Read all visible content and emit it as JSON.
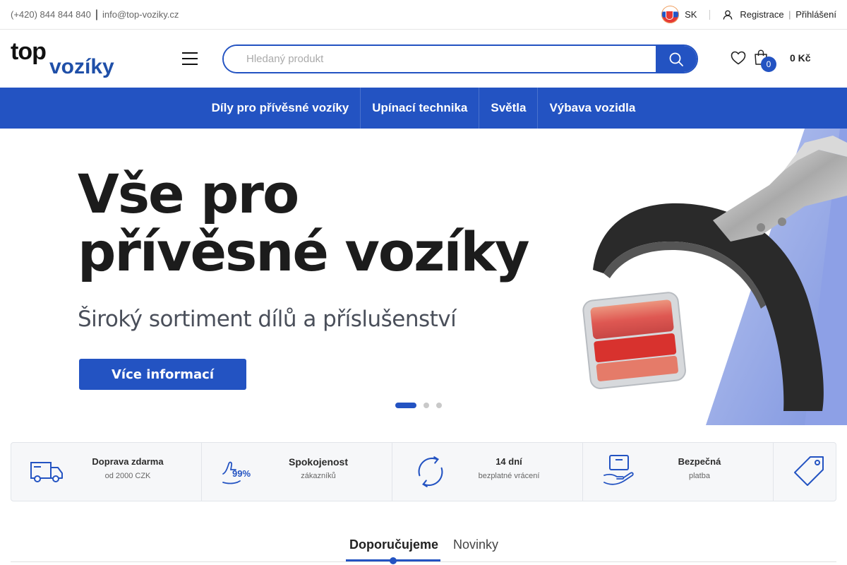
{
  "topbar": {
    "phone": "(+420) 844 844 840",
    "separator": "|",
    "email": "info@top-voziky.cz",
    "language": "SK",
    "register": "Registrace",
    "auth_separator": "|",
    "login": "Přihlášení"
  },
  "header": {
    "logo_top": "top",
    "logo_bottom": "vozíky",
    "search_placeholder": "Hledaný produkt",
    "cart_count": "0",
    "cart_total": "0 Kč"
  },
  "nav": {
    "items": [
      "Díly pro přívěsné vozíky",
      "Upínací technika",
      "Světla",
      "Výbava vozidla"
    ]
  },
  "hero": {
    "title_line1": "Vše pro",
    "title_line2": "přívěsné vozíky",
    "subtitle": "Široký sortiment dílů a příslušenství",
    "cta": "Více informací",
    "active_slide": 1,
    "slide_count": 3
  },
  "features": [
    {
      "title": "Doprava zdarma",
      "subtitle": "od 2000 CZK",
      "icon": "truck-icon"
    },
    {
      "title": "Spokojenost",
      "subtitle": "zákazníků",
      "icon": "thumbs-up-99-icon",
      "icon_text": "99%"
    },
    {
      "title": "14 dní",
      "subtitle": "bezplatné vrácení",
      "icon": "return-cycle-icon"
    },
    {
      "title": "Bezpečná",
      "subtitle": "platba",
      "icon": "secure-payment-icon"
    },
    {
      "title": "",
      "subtitle": "",
      "icon": "price-tag-icon"
    }
  ],
  "tabs": {
    "items": [
      "Doporučujeme",
      "Novinky"
    ],
    "active": 0
  },
  "colors": {
    "brand_blue": "#2353c2",
    "dark_text": "#1c1c1c",
    "logo_blue": "#1f4fa8"
  }
}
